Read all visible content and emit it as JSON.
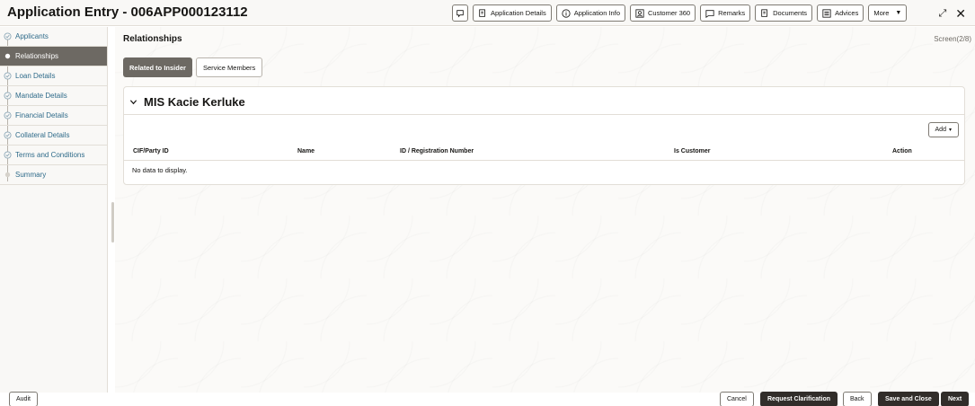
{
  "header": {
    "title": "Application Entry - 006APP000123112",
    "toolbar": [
      {
        "label": "",
        "icon": "chat-icon"
      },
      {
        "label": "Application Details",
        "icon": "document-icon"
      },
      {
        "label": "Application Info",
        "icon": "info-icon"
      },
      {
        "label": "Customer 360",
        "icon": "customer-icon"
      },
      {
        "label": "Remarks",
        "icon": "comment-icon"
      },
      {
        "label": "Documents",
        "icon": "document-icon"
      },
      {
        "label": "Advices",
        "icon": "advice-icon"
      },
      {
        "label": "More",
        "icon": "caret-down-icon"
      }
    ]
  },
  "sidebar": {
    "items": [
      {
        "label": "Applicants",
        "state": "done"
      },
      {
        "label": "Relationships",
        "state": "active"
      },
      {
        "label": "Loan Details",
        "state": "done"
      },
      {
        "label": "Mandate Details",
        "state": "done"
      },
      {
        "label": "Financial Details",
        "state": "done"
      },
      {
        "label": "Collateral Details",
        "state": "done"
      },
      {
        "label": "Terms and Conditions",
        "state": "done"
      },
      {
        "label": "Summary",
        "state": "pending"
      }
    ]
  },
  "main": {
    "title": "Relationships",
    "screen": "Screen(2/8)",
    "tabs": [
      {
        "label": "Related to Insider",
        "active": true
      },
      {
        "label": "Service Members",
        "active": false
      }
    ],
    "panel": {
      "title": "MIS Kacie Kerluke",
      "add_label": "Add",
      "columns": [
        "CIF/Party ID",
        "Name",
        "ID / Registration Number",
        "Is Customer",
        "Action"
      ],
      "empty_text": "No data to display."
    }
  },
  "footer": {
    "audit": "Audit",
    "cancel": "Cancel",
    "request_clarification": "Request Clarification",
    "back": "Back",
    "save_close": "Save and Close",
    "next": "Next"
  },
  "colors": {
    "active_nav": "#6d6963",
    "link_text": "#2f6b8a",
    "primary_button": "#312d2a"
  }
}
